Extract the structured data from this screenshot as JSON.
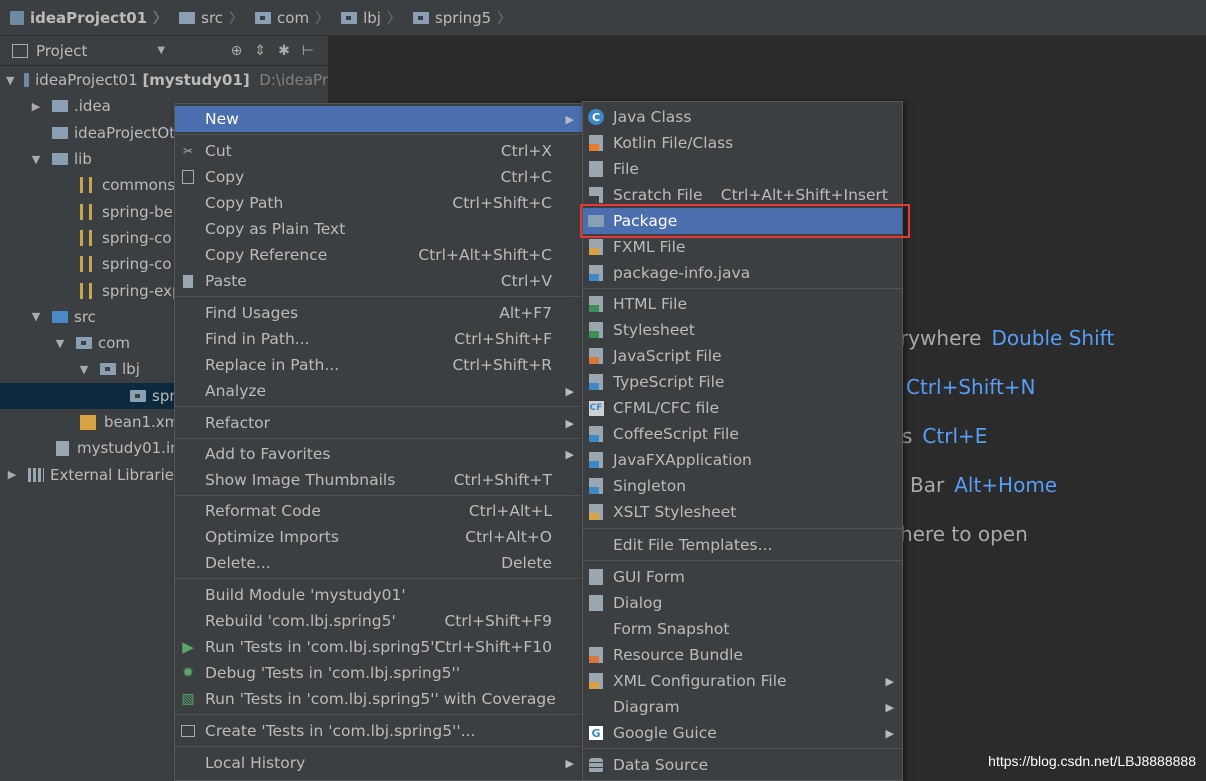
{
  "breadcrumb": [
    "ideaProject01",
    "src",
    "com",
    "lbj",
    "spring5"
  ],
  "panel": {
    "title": "Project"
  },
  "tree": [
    {
      "label": "ideaProject01",
      "extra": "[mystudy01]",
      "path": "D:\\ideaPr"
    },
    {
      "label": ".idea"
    },
    {
      "label": "ideaProjectOt"
    },
    {
      "label": "lib"
    },
    {
      "label": "commons"
    },
    {
      "label": "spring-be"
    },
    {
      "label": "spring-co"
    },
    {
      "label": "spring-co"
    },
    {
      "label": "spring-exp"
    },
    {
      "label": "src"
    },
    {
      "label": "com"
    },
    {
      "label": "lbj"
    },
    {
      "label": "spr"
    },
    {
      "label": "bean1.xml"
    },
    {
      "label": "mystudy01.im"
    },
    {
      "label": "External Libraries"
    }
  ],
  "hints": [
    {
      "text": "rywhere",
      "key": "Double Shift"
    },
    {
      "text": "",
      "key": "Ctrl+Shift+N"
    },
    {
      "text": "s",
      "key": "Ctrl+E"
    },
    {
      "text": "Bar",
      "key": "Alt+Home"
    },
    {
      "text": "here to open",
      "key": ""
    }
  ],
  "context_menu": {
    "items": [
      {
        "label": "New",
        "shortcut": ""
      },
      {
        "label": "Cut",
        "shortcut": "Ctrl+X"
      },
      {
        "label": "Copy",
        "shortcut": "Ctrl+C"
      },
      {
        "label": "Copy Path",
        "shortcut": "Ctrl+Shift+C"
      },
      {
        "label": "Copy as Plain Text",
        "shortcut": ""
      },
      {
        "label": "Copy Reference",
        "shortcut": "Ctrl+Alt+Shift+C"
      },
      {
        "label": "Paste",
        "shortcut": "Ctrl+V"
      },
      {
        "label": "Find Usages",
        "shortcut": "Alt+F7"
      },
      {
        "label": "Find in Path...",
        "shortcut": "Ctrl+Shift+F"
      },
      {
        "label": "Replace in Path...",
        "shortcut": "Ctrl+Shift+R"
      },
      {
        "label": "Analyze",
        "shortcut": ""
      },
      {
        "label": "Refactor",
        "shortcut": ""
      },
      {
        "label": "Add to Favorites",
        "shortcut": ""
      },
      {
        "label": "Show Image Thumbnails",
        "shortcut": "Ctrl+Shift+T"
      },
      {
        "label": "Reformat Code",
        "shortcut": "Ctrl+Alt+L"
      },
      {
        "label": "Optimize Imports",
        "shortcut": "Ctrl+Alt+O"
      },
      {
        "label": "Delete...",
        "shortcut": "Delete"
      },
      {
        "label": "Build Module 'mystudy01'",
        "shortcut": ""
      },
      {
        "label": "Rebuild 'com.lbj.spring5'",
        "shortcut": "Ctrl+Shift+F9"
      },
      {
        "label": "Run 'Tests in 'com.lbj.spring5''",
        "shortcut": "Ctrl+Shift+F10"
      },
      {
        "label": "Debug 'Tests in 'com.lbj.spring5''",
        "shortcut": ""
      },
      {
        "label": "Run 'Tests in 'com.lbj.spring5'' with Coverage",
        "shortcut": ""
      },
      {
        "label": "Create 'Tests in 'com.lbj.spring5''...",
        "shortcut": ""
      },
      {
        "label": "Local History",
        "shortcut": ""
      }
    ]
  },
  "new_submenu": {
    "items": [
      {
        "label": "Java Class",
        "shortcut": ""
      },
      {
        "label": "Kotlin File/Class",
        "shortcut": ""
      },
      {
        "label": "File",
        "shortcut": ""
      },
      {
        "label": "Scratch File",
        "shortcut": "Ctrl+Alt+Shift+Insert"
      },
      {
        "label": "Package",
        "shortcut": ""
      },
      {
        "label": "FXML File",
        "shortcut": ""
      },
      {
        "label": "package-info.java",
        "shortcut": ""
      },
      {
        "label": "HTML File",
        "shortcut": ""
      },
      {
        "label": "Stylesheet",
        "shortcut": ""
      },
      {
        "label": "JavaScript File",
        "shortcut": ""
      },
      {
        "label": "TypeScript File",
        "shortcut": ""
      },
      {
        "label": "CFML/CFC file",
        "shortcut": ""
      },
      {
        "label": "CoffeeScript File",
        "shortcut": ""
      },
      {
        "label": "JavaFXApplication",
        "shortcut": ""
      },
      {
        "label": "Singleton",
        "shortcut": ""
      },
      {
        "label": "XSLT Stylesheet",
        "shortcut": ""
      },
      {
        "label": "Edit File Templates...",
        "shortcut": ""
      },
      {
        "label": "GUI Form",
        "shortcut": ""
      },
      {
        "label": "Dialog",
        "shortcut": ""
      },
      {
        "label": "Form Snapshot",
        "shortcut": ""
      },
      {
        "label": "Resource Bundle",
        "shortcut": ""
      },
      {
        "label": "XML Configuration File",
        "shortcut": ""
      },
      {
        "label": "Diagram",
        "shortcut": ""
      },
      {
        "label": "Google Guice",
        "shortcut": ""
      },
      {
        "label": "Data Source",
        "shortcut": ""
      }
    ]
  },
  "watermark": "https://blog.csdn.net/LBJ8888888",
  "colors": {
    "highlight": "#4b6eaf",
    "accent_key": "#589df6",
    "annotation": "#e53935"
  }
}
